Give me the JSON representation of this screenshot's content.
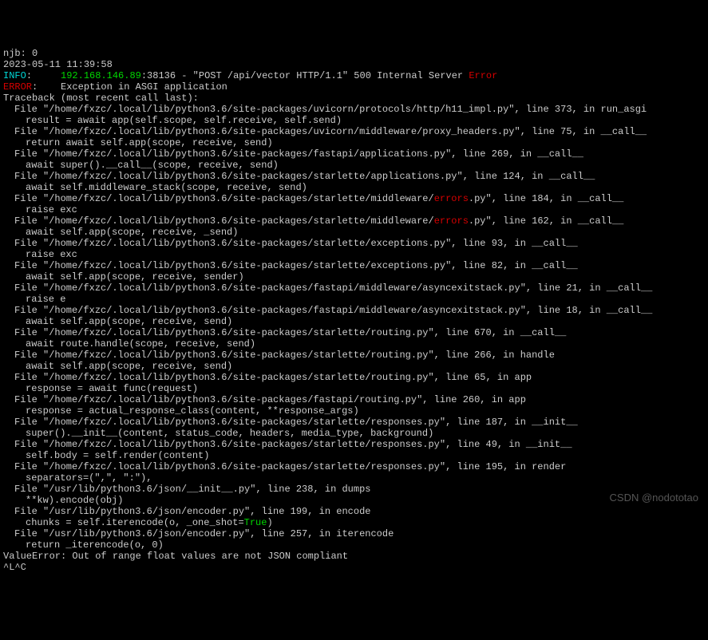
{
  "header_fragment": "njb: 0",
  "timestamp": "2023-05-11 11:39:58",
  "info_label": "INFO",
  "ip": "192.168.146.89",
  "info_rest": ":38136 - \"POST /api/vector HTTP/1.1\" 500 Internal Server ",
  "error_word": "Error",
  "error_label": "ERROR",
  "error_rest": ":    Exception in ASGI application",
  "traceback_header": "Traceback (most recent call last):",
  "frames": [
    {
      "file": "File \"/home/fxzc/.local/lib/python3.6/site-packages/uvicorn/protocols/http/h11_impl.py\", line 373, in run_asgi",
      "code": "result = await app(self.scope, self.receive, self.send)"
    },
    {
      "file": "File \"/home/fxzc/.local/lib/python3.6/site-packages/uvicorn/middleware/proxy_headers.py\", line 75, in __call__",
      "code": "return await self.app(scope, receive, send)"
    },
    {
      "file": "File \"/home/fxzc/.local/lib/python3.6/site-packages/fastapi/applications.py\", line 269, in __call__",
      "code": "await super().__call__(scope, receive, send)"
    },
    {
      "file": "File \"/home/fxzc/.local/lib/python3.6/site-packages/starlette/applications.py\", line 124, in __call__",
      "code": "await self.middleware_stack(scope, receive, send)"
    },
    {
      "file_pre": "File \"/home/fxzc/.local/lib/python3.6/site-packages/starlette/middleware/",
      "file_hl": "errors",
      "file_post": ".py\", line 184, in __call__",
      "code": "raise exc"
    },
    {
      "file_pre": "File \"/home/fxzc/.local/lib/python3.6/site-packages/starlette/middleware/",
      "file_hl": "errors",
      "file_post": ".py\", line 162, in __call__",
      "code": "await self.app(scope, receive, _send)"
    },
    {
      "file": "File \"/home/fxzc/.local/lib/python3.6/site-packages/starlette/exceptions.py\", line 93, in __call__",
      "code": "raise exc"
    },
    {
      "file": "File \"/home/fxzc/.local/lib/python3.6/site-packages/starlette/exceptions.py\", line 82, in __call__",
      "code": "await self.app(scope, receive, sender)"
    },
    {
      "file": "File \"/home/fxzc/.local/lib/python3.6/site-packages/fastapi/middleware/asyncexitstack.py\", line 21, in __call__",
      "code": "raise e"
    },
    {
      "file": "File \"/home/fxzc/.local/lib/python3.6/site-packages/fastapi/middleware/asyncexitstack.py\", line 18, in __call__",
      "code": "await self.app(scope, receive, send)"
    },
    {
      "file": "File \"/home/fxzc/.local/lib/python3.6/site-packages/starlette/routing.py\", line 670, in __call__",
      "code": "await route.handle(scope, receive, send)"
    },
    {
      "file": "File \"/home/fxzc/.local/lib/python3.6/site-packages/starlette/routing.py\", line 266, in handle",
      "code": "await self.app(scope, receive, send)"
    },
    {
      "file": "File \"/home/fxzc/.local/lib/python3.6/site-packages/starlette/routing.py\", line 65, in app",
      "code": "response = await func(request)"
    },
    {
      "file": "File \"/home/fxzc/.local/lib/python3.6/site-packages/fastapi/routing.py\", line 260, in app",
      "code": "response = actual_response_class(content, **response_args)"
    },
    {
      "file": "File \"/home/fxzc/.local/lib/python3.6/site-packages/starlette/responses.py\", line 187, in __init__",
      "code": "super().__init__(content, status_code, headers, media_type, background)"
    },
    {
      "file": "File \"/home/fxzc/.local/lib/python3.6/site-packages/starlette/responses.py\", line 49, in __init__",
      "code": "self.body = self.render(content)"
    },
    {
      "file": "File \"/home/fxzc/.local/lib/python3.6/site-packages/starlette/responses.py\", line 195, in render",
      "code": "separators=(\",\", \":\"),"
    },
    {
      "file": "File \"/usr/lib/python3.6/json/__init__.py\", line 238, in dumps",
      "code": "**kw).encode(obj)"
    },
    {
      "file_pre": "File \"/usr/lib/python3.6/json/encoder.py\", line 199, in encode",
      "code_pre": "chunks = self.iterencode(o, _one_shot=",
      "code_hl": "True",
      "code_post": ")"
    },
    {
      "file": "File \"/usr/lib/python3.6/json/encoder.py\", line 257, in iterencode",
      "code": "return _iterencode(o, 0)"
    }
  ],
  "exception": "ValueError: Out of range float values are not JSON compliant",
  "ctrl": "^L^C",
  "watermark": "CSDN @nodototao"
}
